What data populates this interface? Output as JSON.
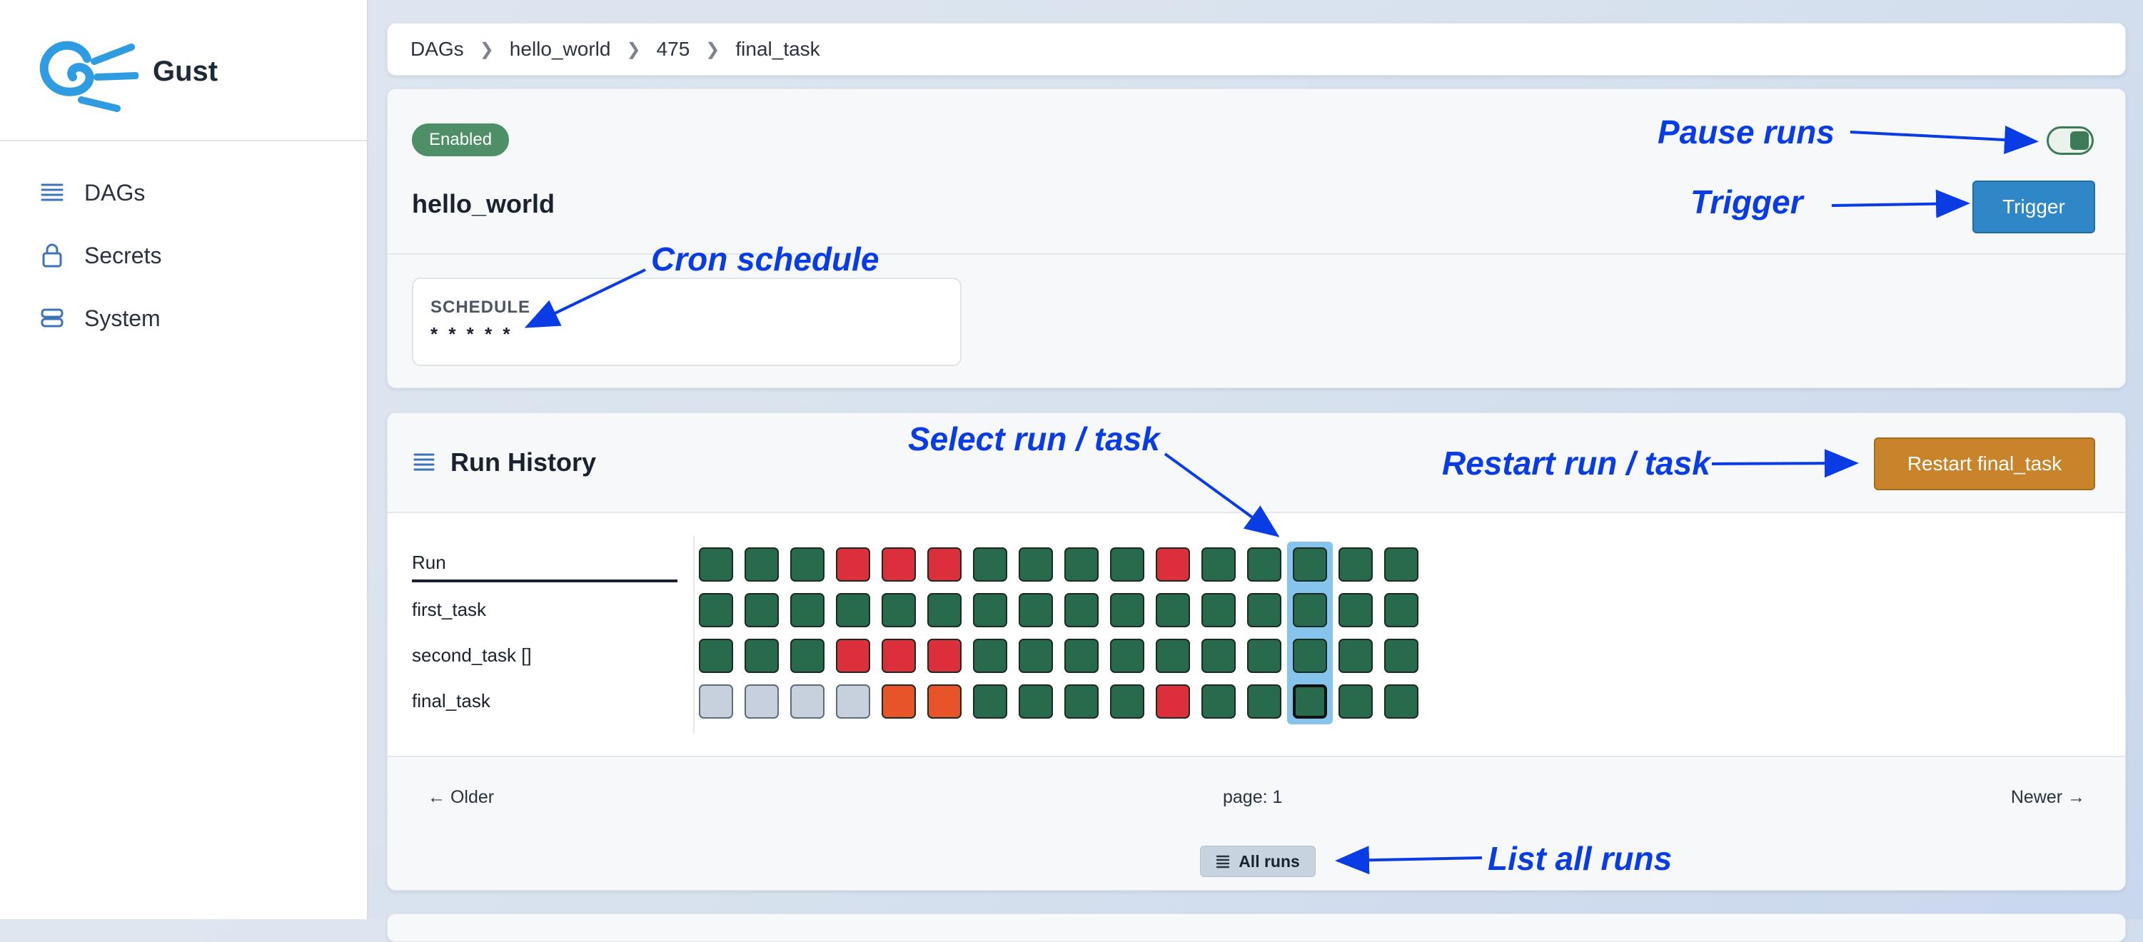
{
  "app": {
    "name": "Gust"
  },
  "sidebar": {
    "items": [
      {
        "label": "DAGs",
        "icon": "list-icon"
      },
      {
        "label": "Secrets",
        "icon": "lock-icon"
      },
      {
        "label": "System",
        "icon": "database-icon"
      }
    ]
  },
  "breadcrumb": [
    "DAGs",
    "hello_world",
    "475",
    "final_task"
  ],
  "dag": {
    "status": "Enabled",
    "name": "hello_world",
    "trigger_label": "Trigger",
    "paused": false,
    "schedule_label": "SCHEDULE",
    "schedule_value": "* * * * *"
  },
  "run_history": {
    "title": "Run History",
    "restart_label": "Restart final_task",
    "rows": [
      {
        "label": "Run",
        "states": [
          "success",
          "success",
          "success",
          "failed",
          "failed",
          "failed",
          "success",
          "success",
          "success",
          "success",
          "failed",
          "success",
          "success",
          "success",
          "success",
          "success"
        ]
      },
      {
        "label": "first_task",
        "states": [
          "success",
          "success",
          "success",
          "success",
          "success",
          "success",
          "success",
          "success",
          "success",
          "success",
          "success",
          "success",
          "success",
          "success",
          "success",
          "success"
        ]
      },
      {
        "label": "second_task []",
        "states": [
          "success",
          "success",
          "success",
          "failed",
          "failed",
          "failed",
          "success",
          "success",
          "success",
          "success",
          "success",
          "success",
          "success",
          "success",
          "success",
          "success"
        ]
      },
      {
        "label": "final_task",
        "states": [
          "queued",
          "queued",
          "queued",
          "queued",
          "upstream_failed",
          "upstream_failed",
          "success",
          "success",
          "success",
          "success",
          "failed",
          "success",
          "success",
          "success",
          "success",
          "success"
        ]
      }
    ],
    "selected_run_index": 13,
    "selected_task": "final_task",
    "state_colors": {
      "success": "#276b4c",
      "failed": "#dc2f3c",
      "queued": "#c7d1de",
      "upstream_failed": "#e8542a"
    },
    "older_label": "← Older",
    "page_label": "page: 1",
    "newer_label": "Newer →",
    "all_runs_label": "All runs"
  },
  "annotations": {
    "pause_runs": "Pause runs",
    "trigger": "Trigger",
    "cron_schedule": "Cron  schedule",
    "select_run_task": "Select run / task",
    "restart_run_task": "Restart run / task",
    "list_all_runs": "List all runs"
  }
}
